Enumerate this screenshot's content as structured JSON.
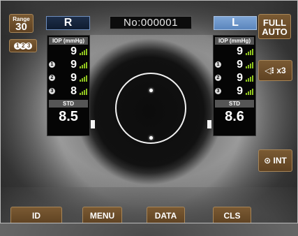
{
  "range": {
    "label": "Range",
    "value": "30"
  },
  "sequence_button": {
    "items": [
      "1",
      "2",
      "3"
    ]
  },
  "full_auto": {
    "line1": "FULL",
    "line2": "AUTO"
  },
  "volume": {
    "label": "◁⁝ x3"
  },
  "int_button": {
    "label": "⊙ INT"
  },
  "patient_no": "No:000001",
  "right_eye": {
    "label": "R",
    "iop_header": "IOP (mmHg)",
    "iop_main": "9",
    "measurements": [
      {
        "n": "1",
        "value": "9"
      },
      {
        "n": "2",
        "value": "9"
      },
      {
        "n": "3",
        "value": "8"
      }
    ],
    "std_header": "STD",
    "std_value": "8.5"
  },
  "left_eye": {
    "label": "L",
    "iop_header": "IOP (mmHg)",
    "iop_main": "9",
    "measurements": [
      {
        "n": "1",
        "value": "9"
      },
      {
        "n": "2",
        "value": "9"
      },
      {
        "n": "3",
        "value": "9"
      }
    ],
    "std_header": "STD",
    "std_value": "8.6"
  },
  "bottom_bar": {
    "id": "ID",
    "menu": "MENU",
    "data": "DATA",
    "cls": "CLS"
  },
  "colors": {
    "button_bg": "#6a4c2b",
    "signal_bars": "#8ec21f",
    "left_eye_active": "#6e97cb"
  },
  "icons": {
    "signal": "signal-strength-icon",
    "speaker": "speaker-icon",
    "target": "target-icon"
  }
}
